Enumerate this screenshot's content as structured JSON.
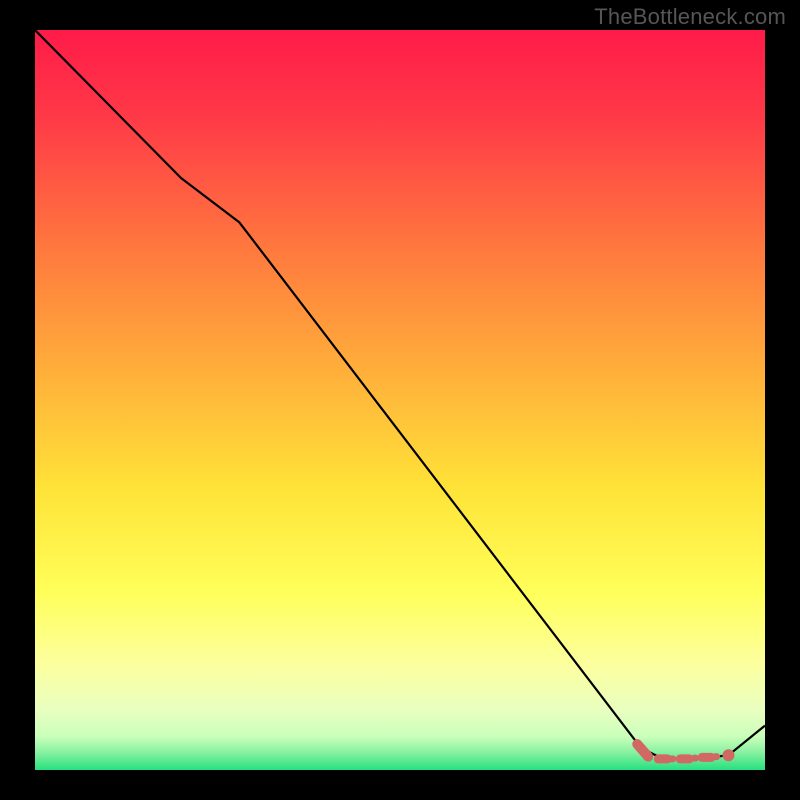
{
  "watermark": "TheBottleneck.com",
  "colors": {
    "gradient_top": "#ff1b49",
    "gradient_mid1": "#ff8a3a",
    "gradient_mid2": "#ffe033",
    "gradient_mid3": "#ffff66",
    "gradient_mid4": "#f4ffb0",
    "gradient_bottom": "#27e07f",
    "line": "#000000",
    "marker": "#d26864"
  },
  "chart_data": {
    "type": "line",
    "title": "",
    "xlabel": "",
    "ylabel": "",
    "xlim": [
      0,
      100
    ],
    "ylim": [
      0,
      100
    ],
    "series": [
      {
        "name": "curve",
        "x": [
          0,
          10,
          20,
          28,
          83,
          86,
          91,
          95,
          100
        ],
        "y": [
          100,
          90,
          80,
          74,
          3,
          1.5,
          1.5,
          2,
          6
        ]
      }
    ],
    "markers": [
      {
        "name": "range-start",
        "x": 83,
        "y": 3,
        "shape": "round"
      },
      {
        "name": "seg-1",
        "x": 86,
        "y": 1.5,
        "shape": "dash"
      },
      {
        "name": "seg-2",
        "x": 89,
        "y": 1.5,
        "shape": "dash"
      },
      {
        "name": "seg-3",
        "x": 92,
        "y": 1.7,
        "shape": "dash"
      },
      {
        "name": "range-end",
        "x": 95,
        "y": 2,
        "shape": "dot"
      }
    ]
  }
}
